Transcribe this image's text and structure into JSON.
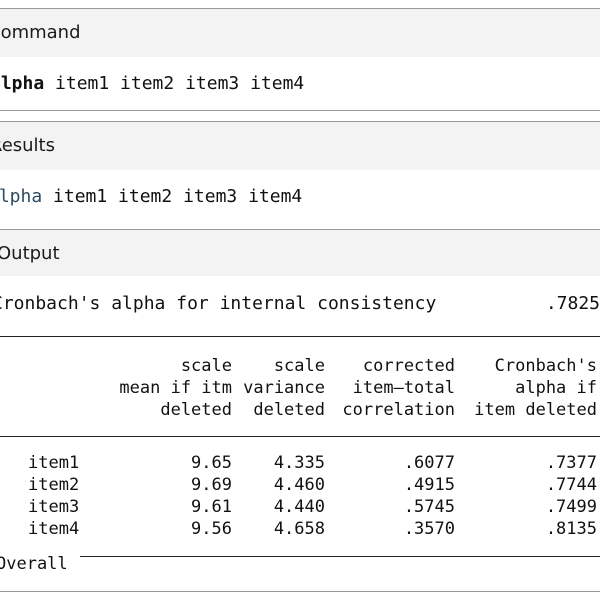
{
  "command_section": {
    "title": "Command",
    "keyword": "alpha",
    "args": " item1 item2 item3 item4"
  },
  "results_section": {
    "title": "Results",
    "keyword": "alpha",
    "args": " item1 item2 item3 item4"
  },
  "output_section": {
    "title": "Output",
    "summary_label": "Cronbach's alpha for internal consistency",
    "summary_value": ".7825",
    "columns": [
      {
        "line1": "scale",
        "line2": "mean if itm",
        "line3": "deleted"
      },
      {
        "line1": "scale",
        "line2": "variance",
        "line3": "deleted"
      },
      {
        "line1": "corrected",
        "line2": "item–total",
        "line3": "correlation"
      },
      {
        "line1": "Cronbach's",
        "line2": "alpha if",
        "line3": "item deleted"
      }
    ],
    "rows": [
      {
        "item": "item1",
        "mean": "9.65",
        "variance": "4.335",
        "corr": ".6077",
        "alpha": ".7377"
      },
      {
        "item": "item2",
        "mean": "9.69",
        "variance": "4.460",
        "corr": ".4915",
        "alpha": ".7744"
      },
      {
        "item": "item3",
        "mean": "9.61",
        "variance": "4.440",
        "corr": ".5745",
        "alpha": ".7499"
      },
      {
        "item": "item4",
        "mean": "9.56",
        "variance": "4.658",
        "corr": ".3570",
        "alpha": ".8135"
      }
    ],
    "overall_label": "Overall"
  }
}
